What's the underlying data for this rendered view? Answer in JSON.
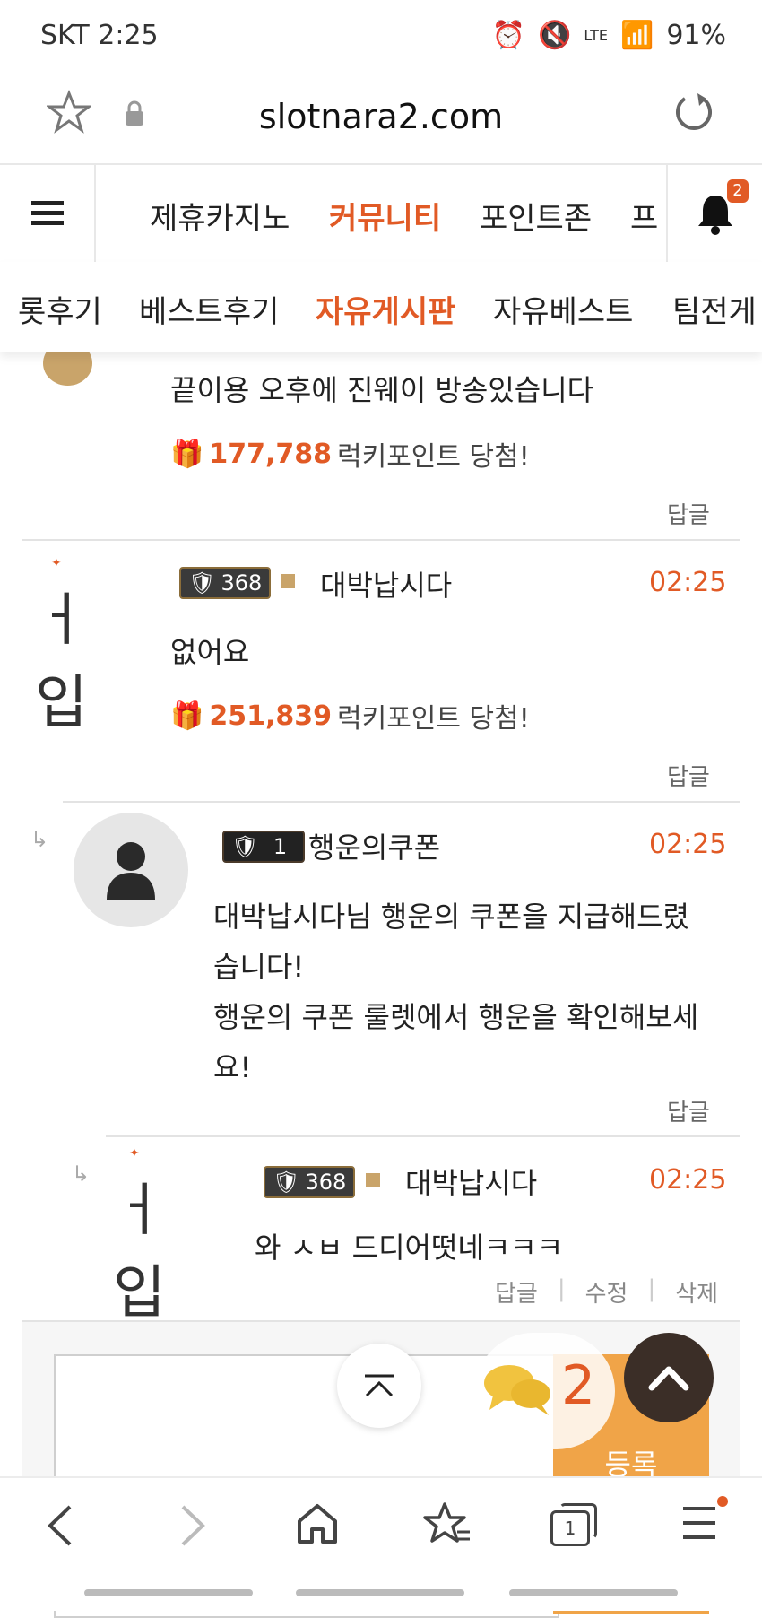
{
  "status_bar": {
    "carrier_time": "SKT  2:25",
    "network": "LTE",
    "battery": "91%"
  },
  "browser": {
    "url": "slotnara2.com"
  },
  "nav": {
    "main_items": [
      "제휴카지노",
      "커뮤니티",
      "포인트존",
      "프"
    ],
    "active_main": "커뮤니티",
    "notification_count": "2",
    "sub_items": [
      "롯후기",
      "베스트후기",
      "자유게시판",
      "자유베스트",
      "팀전게"
    ],
    "active_sub": "자유게시판"
  },
  "comments": [
    {
      "text": "끝이용 오후에 진웨이 방송있습니다",
      "lucky_points": "177,788",
      "lucky_suffix": "럭키포인트 당첨!",
      "reply_label": "답글"
    },
    {
      "level": "368",
      "nickname": "대박납시다",
      "time": "02:25",
      "text": "없어요",
      "lucky_points": "251,839",
      "lucky_suffix": "럭키포인트 당첨!",
      "reply_label": "답글"
    },
    {
      "level": "1",
      "nickname": "행운의쿠폰",
      "time": "02:25",
      "text_lines": [
        "대박납시다님 행운의 쿠폰을 지급해드렸",
        "습니다!",
        "행운의 쿠폰 룰렛에서 행운을 확인해보세",
        "요!"
      ],
      "reply_label": "답글"
    },
    {
      "level": "368",
      "nickname": "대박납시다",
      "time": "02:25",
      "text": "와 ㅅㅂ 드디어떳네ㅋㅋㅋ",
      "actions": [
        "답글",
        "수정",
        "삭제"
      ]
    }
  ],
  "signature_text": "ㅓ입",
  "comment_form": {
    "submit_label": "등록"
  },
  "floating": {
    "comment_count": "2"
  },
  "bottom_bar": {
    "tab_count": "1"
  },
  "colors": {
    "accent": "#e15a25",
    "submit_bg": "#f0a448"
  }
}
